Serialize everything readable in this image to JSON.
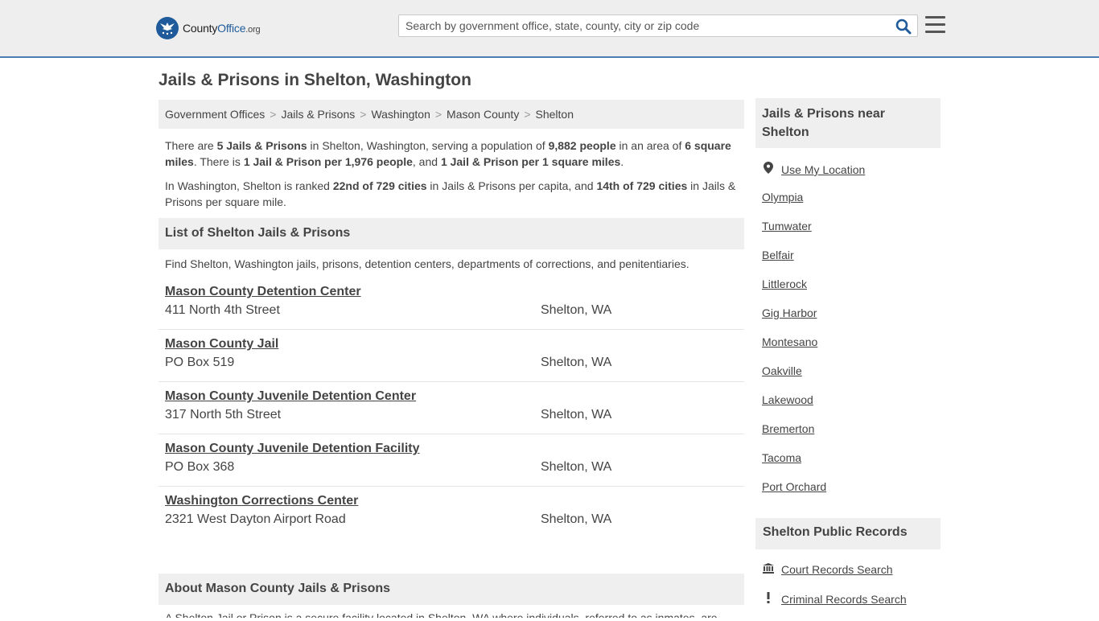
{
  "header": {
    "logo_text_main": "County",
    "logo_text_accent": "Office",
    "logo_text_suffix": ".org",
    "search_placeholder": "Search by government office, state, county, city or zip code"
  },
  "page": {
    "title": "Jails & Prisons in Shelton, Washington"
  },
  "breadcrumb": [
    "Government Offices",
    "Jails & Prisons",
    "Washington",
    "Mason County",
    "Shelton"
  ],
  "intro": {
    "p1": [
      {
        "t": "There are ",
        "b": false
      },
      {
        "t": "5 Jails & Prisons",
        "b": true
      },
      {
        "t": " in Shelton, Washington, serving a population of ",
        "b": false
      },
      {
        "t": "9,882 people",
        "b": true
      },
      {
        "t": " in an area of ",
        "b": false
      },
      {
        "t": "6 square miles",
        "b": true
      },
      {
        "t": ". There is ",
        "b": false
      },
      {
        "t": "1 Jail & Prison per 1,976 people",
        "b": true
      },
      {
        "t": ", and ",
        "b": false
      },
      {
        "t": "1 Jail & Prison per 1 square miles",
        "b": true
      },
      {
        "t": ".",
        "b": false
      }
    ],
    "p2": [
      {
        "t": "In Washington, Shelton is ranked ",
        "b": false
      },
      {
        "t": "22nd of 729 cities",
        "b": true
      },
      {
        "t": " in Jails & Prisons per capita, and ",
        "b": false
      },
      {
        "t": "14th of 729 cities",
        "b": true
      },
      {
        "t": " in Jails & Prisons per square mile.",
        "b": false
      }
    ]
  },
  "list_section": {
    "heading": "List of Shelton Jails & Prisons",
    "description": "Find Shelton, Washington jails, prisons, detention centers, departments of corrections, and penitentiaries.",
    "items": [
      {
        "name": "Mason County Detention Center",
        "address": "411 North 4th Street",
        "city": "Shelton, WA"
      },
      {
        "name": "Mason County Jail",
        "address": "PO Box 519",
        "city": "Shelton, WA"
      },
      {
        "name": "Mason County Juvenile Detention Center",
        "address": "317 North 5th Street",
        "city": "Shelton, WA"
      },
      {
        "name": "Mason County Juvenile Detention Facility",
        "address": "PO Box 368",
        "city": "Shelton, WA"
      },
      {
        "name": "Washington Corrections Center",
        "address": "2321 West Dayton Airport Road",
        "city": "Shelton, WA"
      }
    ]
  },
  "about": {
    "heading": "About Mason County Jails & Prisons",
    "text": "A Shelton Jail or Prison is a secure facility located in Shelton, WA where individuals, referred to as inmates, are"
  },
  "sidebar": {
    "near_heading": "Jails & Prisons near Shelton",
    "use_location": "Use My Location",
    "cities": [
      "Olympia",
      "Tumwater",
      "Belfair",
      "Littlerock",
      "Gig Harbor",
      "Montesano",
      "Oakville",
      "Lakewood",
      "Bremerton",
      "Tacoma",
      "Port Orchard"
    ],
    "records_heading": "Shelton Public Records",
    "records": [
      {
        "label": "Court Records Search",
        "icon": "courthouse-icon"
      },
      {
        "label": "Criminal Records Search",
        "icon": "exclamation-icon"
      }
    ]
  },
  "colors": {
    "accent": "#1f5b9a",
    "header_bg": "#eeeeee",
    "header_border": "#4a7fb5",
    "panel_bg": "#efefef"
  }
}
